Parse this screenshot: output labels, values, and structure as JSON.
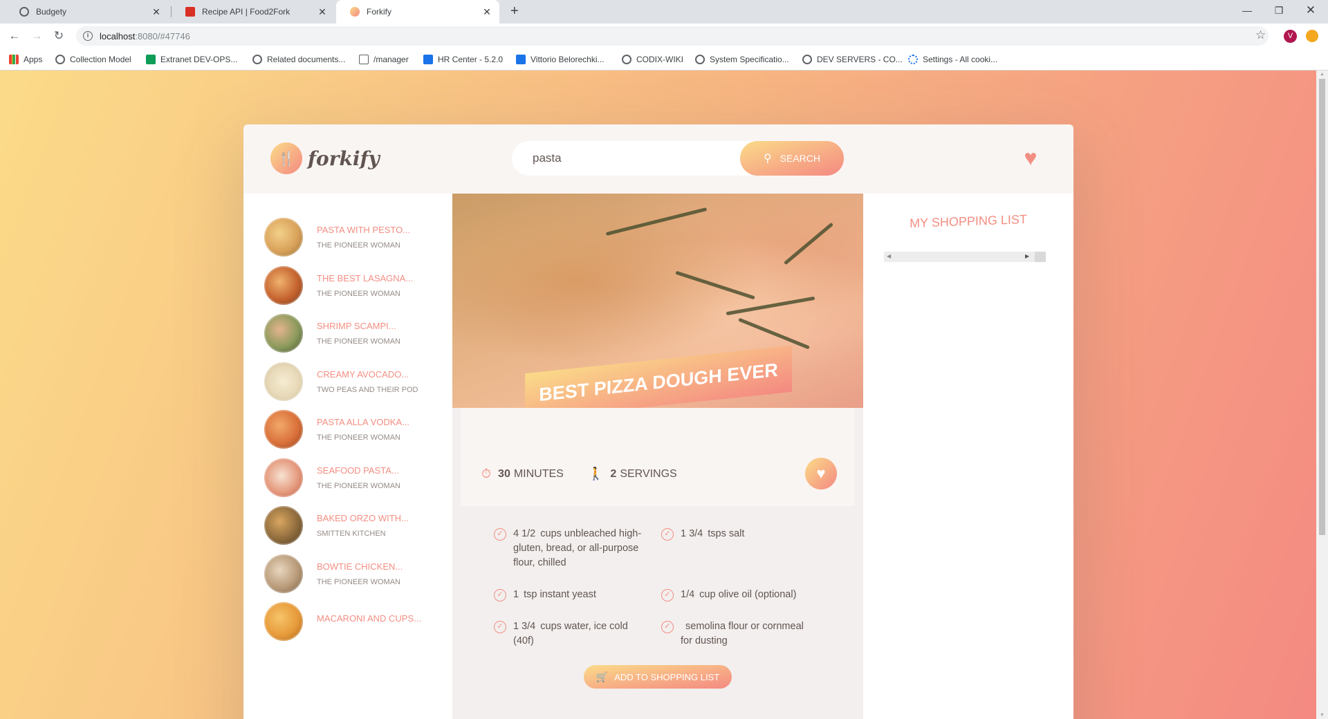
{
  "browser": {
    "tabs": [
      {
        "title": "Budgety",
        "fav_color": "#5f6368"
      },
      {
        "title": "Recipe API | Food2Fork",
        "fav_color": "#d93025"
      },
      {
        "title": "Forkify",
        "fav_color": "#f6a57c"
      }
    ],
    "url_host": "localhost",
    "url_path": ":8080/#47746",
    "profile_initial": "V",
    "bookmarks": [
      "Apps",
      "Collection Model",
      "Extranet DEV-OPS...",
      "Related documents...",
      "/manager",
      "HR Center -  5.2.0",
      "Vittorio Belorechki...",
      "CODIX-WIKI",
      "System Specificatio...",
      "DEV SERVERS - CO...",
      "Settings - All cooki..."
    ]
  },
  "app": {
    "logo_text": "forkify",
    "search_value": "pasta",
    "search_button": "Search",
    "accent": "#f38e82"
  },
  "results": [
    {
      "title": "Pasta with Pesto...",
      "publisher": "The Pioneer Woman",
      "tone": "#d9a25a"
    },
    {
      "title": "The Best Lasagna...",
      "publisher": "The Pioneer Woman",
      "tone": "#c4622e"
    },
    {
      "title": "Shrimp Scampi...",
      "publisher": "The Pioneer Woman",
      "tone": "#8a9a5b"
    },
    {
      "title": "Creamy Avocado...",
      "publisher": "Two Peas and Their Pod",
      "tone": "#e7d9b8"
    },
    {
      "title": "Pasta alla Vodka...",
      "publisher": "The Pioneer Woman",
      "tone": "#d9703a"
    },
    {
      "title": "Seafood Pasta...",
      "publisher": "The Pioneer Woman",
      "tone": "#e59a7e"
    },
    {
      "title": "Baked Orzo with...",
      "publisher": "Smitten Kitchen",
      "tone": "#8d6a3c"
    },
    {
      "title": "Bowtie Chicken...",
      "publisher": "The Pioneer Woman",
      "tone": "#b89a78"
    },
    {
      "title": "Macaroni and Cups...",
      "publisher": "",
      "tone": "#e69a3a"
    }
  ],
  "recipe": {
    "title": "Best Pizza Dough Ever",
    "time_value": "30",
    "time_unit": "minutes",
    "servings_value": "2",
    "servings_unit": "servings",
    "ingredients": [
      {
        "count": "4 1/2",
        "text": "cups unbleached high-gluten, bread, or all-purpose flour, chilled"
      },
      {
        "count": "1 3/4",
        "text": "tsps salt"
      },
      {
        "count": "1",
        "text": "tsp instant yeast"
      },
      {
        "count": "1/4",
        "text": "cup olive oil (optional)"
      },
      {
        "count": "1 3/4",
        "text": "cups water, ice cold (40f)"
      },
      {
        "count": "",
        "text": "semolina flour or cornmeal for dusting"
      }
    ],
    "add_button": "Add to shopping list"
  },
  "shopping": {
    "title": "My Shopping List"
  }
}
